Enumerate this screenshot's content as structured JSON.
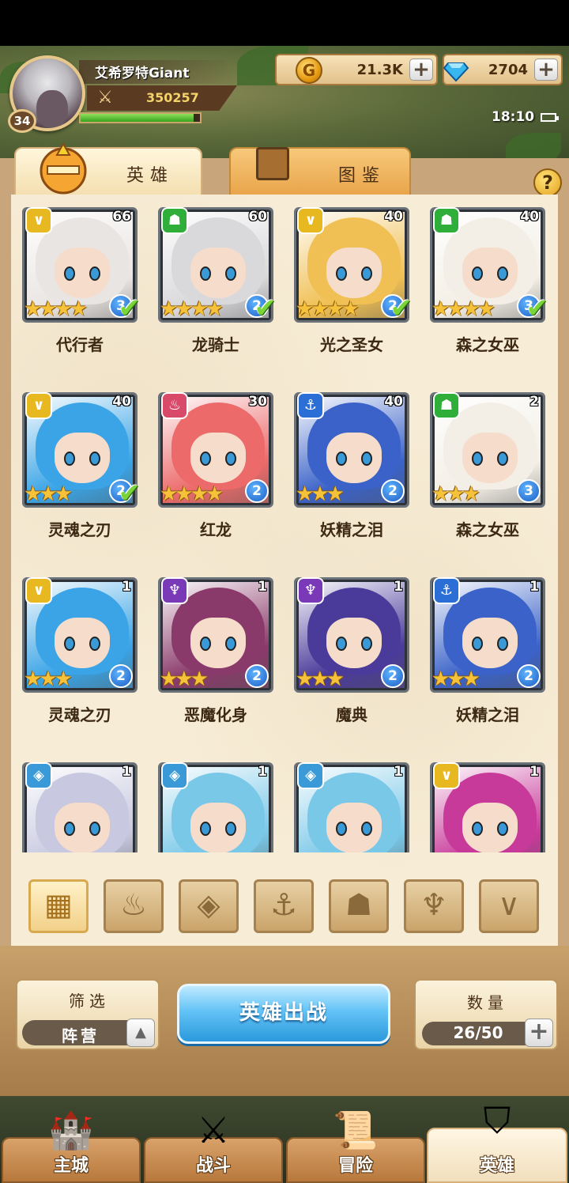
{
  "player": {
    "name": "艾希罗特Giant",
    "level": "34",
    "power": "350257",
    "exp_fraction": 0.95
  },
  "resources": {
    "gold": "21.3K",
    "gold_icon_glyph": "G",
    "gems": "2704",
    "plus": "+"
  },
  "clock": "18:10",
  "tabs": [
    {
      "label": "英雄",
      "active": true
    },
    {
      "label": "图鉴",
      "active": false
    }
  ],
  "help_label": "?",
  "heroes": [
    {
      "name": "代行者",
      "level": "66",
      "stars": 4,
      "grade": "3",
      "faction_icon": "chevron-icon",
      "faction_color": "#e8b820",
      "deployed": true,
      "hair": "#e9e5e2"
    },
    {
      "name": "龙骑士",
      "level": "60",
      "stars": 4,
      "grade": "2",
      "faction_icon": "beast-icon",
      "faction_color": "#2fae3a",
      "deployed": true,
      "hair": "#d9d9dc"
    },
    {
      "name": "光之圣女",
      "level": "40",
      "stars": 4,
      "grade": "2",
      "faction_icon": "chevron-icon",
      "faction_color": "#e8b820",
      "deployed": true,
      "hair": "#f0c054"
    },
    {
      "name": "森之女巫",
      "level": "40",
      "stars": 4,
      "grade": "3",
      "faction_icon": "beast-icon",
      "faction_color": "#2fae3a",
      "deployed": true,
      "hair": "#f3efe6"
    },
    {
      "name": "灵魂之刃",
      "level": "40",
      "stars": 3,
      "grade": "2",
      "faction_icon": "chevron-icon",
      "faction_color": "#e8b820",
      "deployed": true,
      "hair": "#3aa4e6"
    },
    {
      "name": "红龙",
      "level": "30",
      "stars": 4,
      "grade": "2",
      "faction_icon": "flame-icon",
      "faction_color": "#d94a6a",
      "deployed": false,
      "hair": "#ec6a6a"
    },
    {
      "name": "妖精之泪",
      "level": "40",
      "stars": 3,
      "grade": "2",
      "faction_icon": "anchor-icon",
      "faction_color": "#2b6fd6",
      "deployed": false,
      "hair": "#3a62c8"
    },
    {
      "name": "森之女巫",
      "level": "2",
      "stars": 3,
      "grade": "3",
      "faction_icon": "beast-icon",
      "faction_color": "#2fae3a",
      "deployed": false,
      "hair": "#f3efe6"
    },
    {
      "name": "灵魂之刃",
      "level": "1",
      "stars": 3,
      "grade": "2",
      "faction_icon": "chevron-icon",
      "faction_color": "#e8b820",
      "deployed": false,
      "hair": "#3aa4e6"
    },
    {
      "name": "恶魔化身",
      "level": "1",
      "stars": 3,
      "grade": "2",
      "faction_icon": "horns-icon",
      "faction_color": "#7a3ab8",
      "deployed": false,
      "hair": "#8a3a6a"
    },
    {
      "name": "魔典",
      "level": "1",
      "stars": 3,
      "grade": "2",
      "faction_icon": "horns-icon",
      "faction_color": "#7a3ab8",
      "deployed": false,
      "hair": "#4a3a9a"
    },
    {
      "name": "妖精之泪",
      "level": "1",
      "stars": 3,
      "grade": "2",
      "faction_icon": "anchor-icon",
      "faction_color": "#2b6fd6",
      "deployed": false,
      "hair": "#3a62c8"
    },
    {
      "name": "",
      "level": "1",
      "stars": 0,
      "grade": "",
      "faction_icon": "diamond-icon",
      "faction_color": "#3a9ad8",
      "deployed": false,
      "hair": "#c8c8e0"
    },
    {
      "name": "",
      "level": "1",
      "stars": 0,
      "grade": "",
      "faction_icon": "diamond-icon",
      "faction_color": "#3a9ad8",
      "deployed": false,
      "hair": "#7ac8e8"
    },
    {
      "name": "",
      "level": "1",
      "stars": 0,
      "grade": "",
      "faction_icon": "diamond-icon",
      "faction_color": "#3a9ad8",
      "deployed": false,
      "hair": "#7ac8e8"
    },
    {
      "name": "",
      "level": "1",
      "stars": 0,
      "grade": "",
      "faction_icon": "chevron-icon",
      "faction_color": "#e8b820",
      "deployed": false,
      "hair": "#c83a9a"
    }
  ],
  "faction_filters": [
    {
      "icon": "all-grid-icon",
      "glyph": "▦",
      "active": true
    },
    {
      "icon": "flame-icon",
      "glyph": "♨",
      "active": false
    },
    {
      "icon": "diamond-icon",
      "glyph": "◈",
      "active": false
    },
    {
      "icon": "anchor-icon",
      "glyph": "⚓",
      "active": false
    },
    {
      "icon": "beast-icon",
      "glyph": "☗",
      "active": false
    },
    {
      "icon": "horns-icon",
      "glyph": "♆",
      "active": false
    },
    {
      "icon": "chevron-icon",
      "glyph": "∨",
      "active": false
    }
  ],
  "filter": {
    "label": "筛选",
    "value": "阵营",
    "toggle_glyph": "▲"
  },
  "deploy_button": "英雄出战",
  "count": {
    "label": "数量",
    "value": "26/50",
    "plus": "+"
  },
  "bottom_nav": [
    {
      "label": "主城",
      "icon": "castle-icon",
      "glyph": "🏰",
      "active": false
    },
    {
      "label": "战斗",
      "icon": "crossed-swords-icon",
      "glyph": "⚔",
      "active": false
    },
    {
      "label": "冒险",
      "icon": "map-scroll-icon",
      "glyph": "📜",
      "active": false
    },
    {
      "label": "英雄",
      "icon": "hero-crest-icon",
      "glyph": "⛉",
      "active": true
    }
  ],
  "faction_glyphs": {
    "chevron-icon": "∨",
    "beast-icon": "☗",
    "flame-icon": "♨",
    "anchor-icon": "⚓",
    "horns-icon": "♆",
    "diamond-icon": "◈"
  }
}
